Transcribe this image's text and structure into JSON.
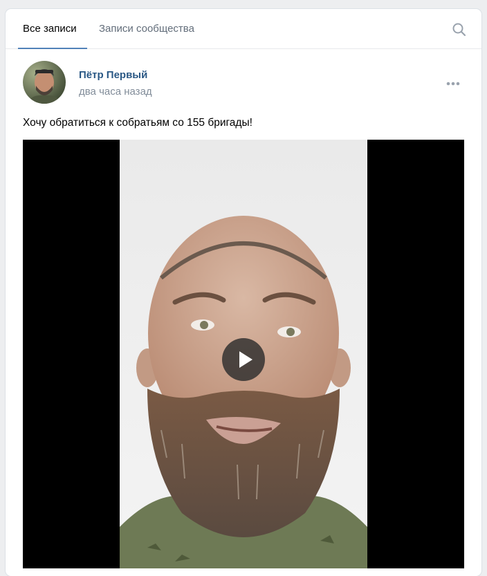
{
  "tabs": {
    "all_posts": "Все записи",
    "community_posts": "Записи сообщества"
  },
  "post": {
    "author": "Пётр Первый",
    "time": "два часа назад",
    "text": "Хочу обратиться к собратьям со 155 бригады!"
  },
  "icons": {
    "search": "search-icon",
    "more": "more-icon",
    "play": "play-icon"
  },
  "colors": {
    "accent": "#5181b8",
    "author_link": "#2a5885",
    "muted": "#818c99",
    "background": "#edeef0"
  }
}
